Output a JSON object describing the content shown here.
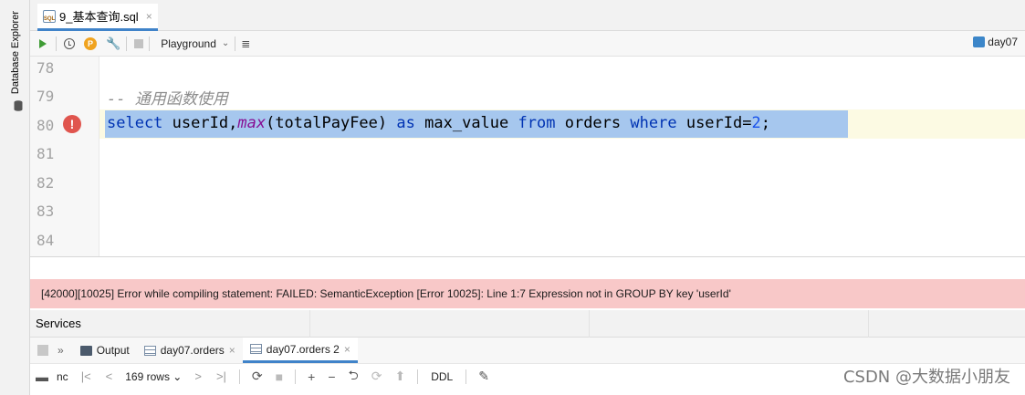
{
  "left_strip": {
    "label": "Database Explorer"
  },
  "tab": {
    "file_icon_text": "SQL",
    "title": "9_基本查询.sql",
    "close": "×"
  },
  "toolbar": {
    "p_badge": "P",
    "playground_label": "Playground",
    "chevron": "⌄",
    "lines_icon": "≣",
    "connection_label": "day07"
  },
  "editor": {
    "line_numbers": [
      "78",
      "79",
      "80",
      "81",
      "82",
      "83",
      "84"
    ],
    "error_marker": "!",
    "comment_line": "-- 通用函数使用",
    "sql_tokens": {
      "select": "select",
      "userId": "userId",
      "comma": ",",
      "max": "max",
      "lparen": "(",
      "totalPayFee": "totalPayFee",
      "rparen": ")",
      "as": "as",
      "alias": "max_value",
      "from": "from",
      "table": "orders",
      "where": "where",
      "cond_field": "userId",
      "eq": "=",
      "value": "2",
      "semicolon": ";"
    }
  },
  "error_message": "[42000][10025] Error while compiling statement: FAILED: SemanticException [Error 10025]: Line 1:7 Expression not in GROUP BY key 'userId'",
  "services": {
    "title": "Services"
  },
  "result_tabs": {
    "expand": "»",
    "items": [
      {
        "label": "Output",
        "close": ""
      },
      {
        "label": "day07.orders",
        "close": "×"
      },
      {
        "label": "day07.orders 2",
        "close": "×"
      }
    ]
  },
  "result_toolbar": {
    "truncated_label": "nc",
    "first": "|<",
    "prev": "<",
    "rows": "169 rows",
    "rows_chevron": "⌄",
    "next": ">",
    "last": ">|",
    "refresh": "⟳",
    "add": "+",
    "remove": "−",
    "revert": "⮌",
    "submit": "⟳",
    "up": "⬆",
    "ddl": "DDL",
    "pin": "📌"
  },
  "watermark": "CSDN @大数据小朋友",
  "colors": {
    "keyword": "#0033b3",
    "function": "#871094",
    "number": "#1750eb",
    "error_bg": "#f8c8c8",
    "selection": "#a6c7ee",
    "error_marker": "#e0554e"
  }
}
